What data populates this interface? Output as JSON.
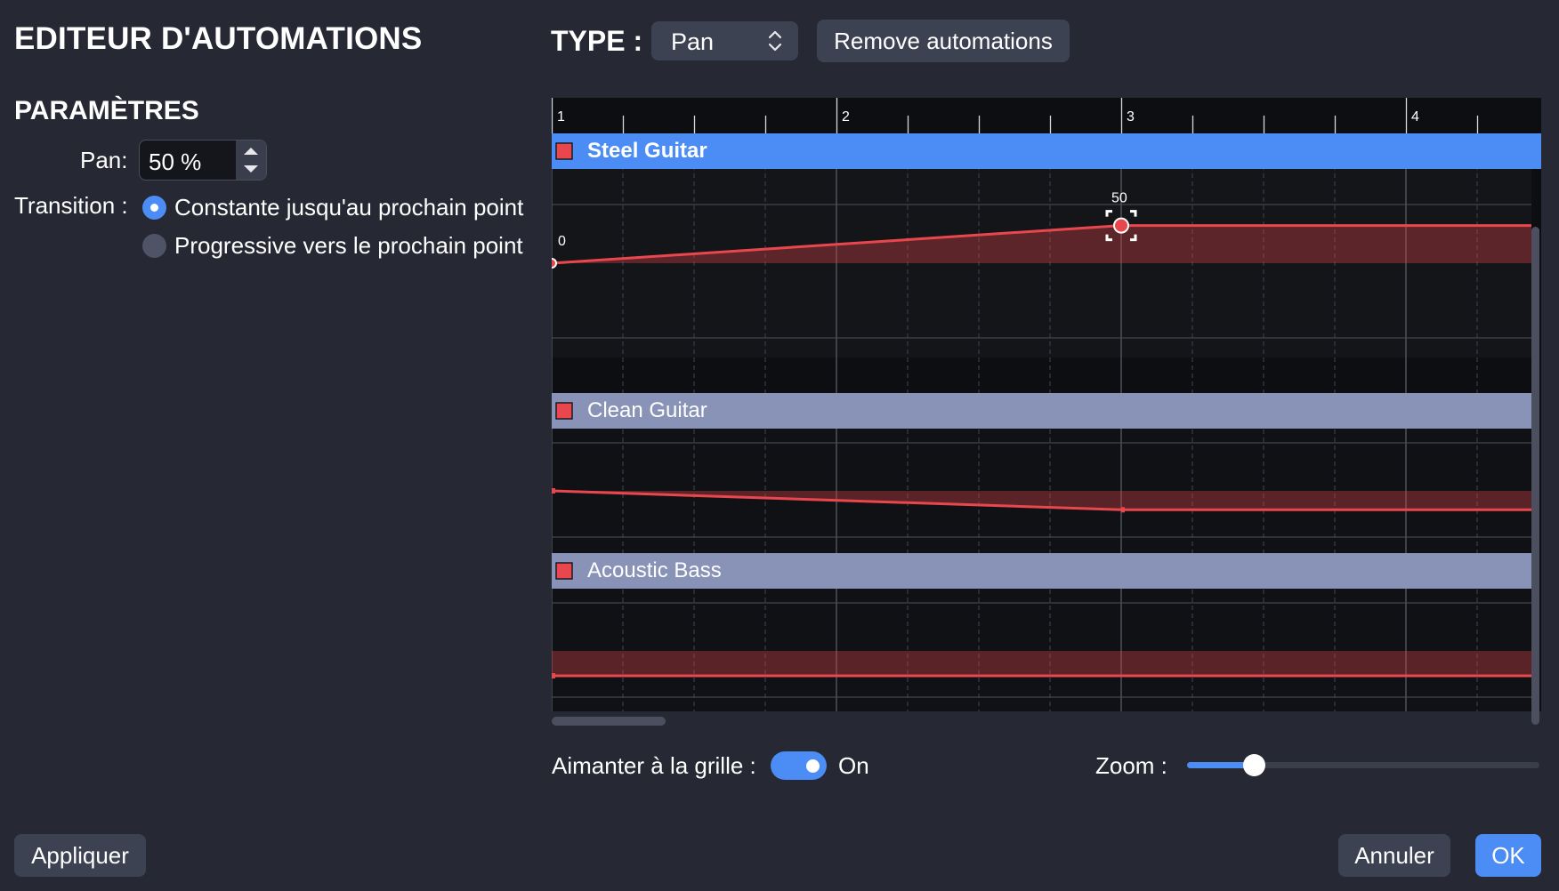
{
  "header": {
    "title": "EDITEUR D'AUTOMATIONS"
  },
  "params": {
    "section_title": "PARAMÈTRES",
    "pan_label": "Pan:",
    "pan_value": "50 %",
    "transition_label": "Transition :",
    "options": [
      {
        "label": "Constante jusqu'au prochain point",
        "selected": true
      },
      {
        "label": "Progressive vers le prochain point",
        "selected": false
      }
    ]
  },
  "type_selector": {
    "label": "TYPE :",
    "value": "Pan"
  },
  "remove_button": "Remove automations",
  "timeline": {
    "bars": [
      "1",
      "2",
      "3",
      "4"
    ],
    "beats_per_bar": 4,
    "tracks": [
      {
        "name": "Steel Guitar",
        "selected": true,
        "points": [
          {
            "bar": 1,
            "value": 0,
            "label": "0"
          },
          {
            "bar": 3,
            "value": 50,
            "label": "50",
            "selected": true
          }
        ]
      },
      {
        "name": "Clean Guitar",
        "selected": false,
        "points": [
          {
            "bar": 1,
            "value": 0
          },
          {
            "bar": 3,
            "value": -38
          }
        ]
      },
      {
        "name": "Acoustic Bass",
        "selected": false,
        "points": [
          {
            "bar": 1,
            "value": -50
          }
        ]
      }
    ]
  },
  "snap": {
    "label": "Aimanter à la grille :",
    "enabled": true,
    "state_text": "On"
  },
  "zoom": {
    "label": "Zoom :",
    "level": 0.19
  },
  "footer": {
    "apply": "Appliquer",
    "cancel": "Annuler",
    "ok": "OK"
  },
  "colors": {
    "background": "#262833",
    "accent": "#4c8cf5",
    "automation": "#e8474d",
    "selected_track": "#4c8cf5",
    "track_header": "#8993b8"
  }
}
